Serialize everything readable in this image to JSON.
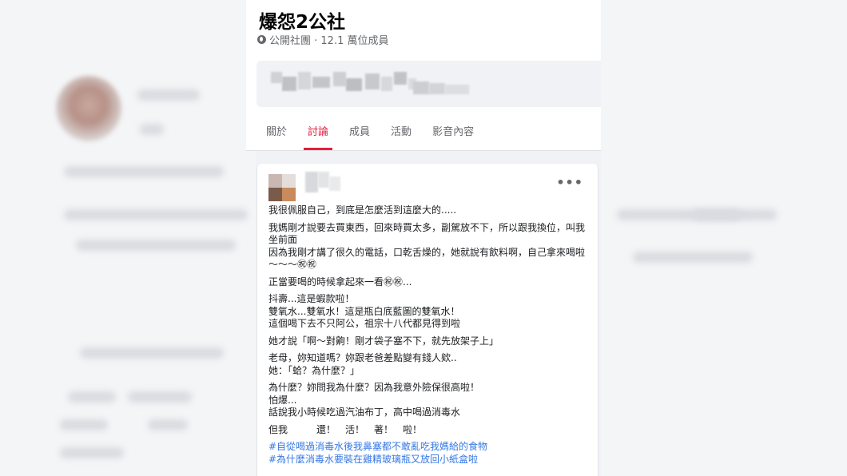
{
  "group": {
    "title": "爆怨2公社",
    "meta": "公開社團 · 12.1 萬位成員"
  },
  "tabs": [
    "關於",
    "討論",
    "成員",
    "活動",
    "影音內容"
  ],
  "active_tab": "討論",
  "post": {
    "more_icon": "•••",
    "paragraphs": [
      "我很佩服自己，到底是怎麼活到這麼大的.....",
      "我媽剛才說要去買東西，回來時買太多，副駕放不下，所以跟我換位，叫我坐前面\n因為我剛才講了很久的電話，口乾舌燥的，她就說有飲料啊，自己拿來喝啦～～～㊗㊗",
      "正當要喝的時候拿起來一看㊗㊗...",
      "抖壽...這是蝦款啦！\n雙氧水...雙氧水！這是瓶白底藍圖的雙氧水！\n這個喝下去不只阿公，祖宗十八代都見得到啦",
      "她才說「啊～對齁！剛才袋子塞不下，就先放架子上」",
      "老母，妳知道嗎？妳跟老爸差點變有錢人欸..\n她：「蛤？為什麼？」",
      "為什麼？妳問我為什麼？因為我意外險保很高啦！\n怕爆...\n話說我小時候吃過汽油布丁，高中喝過消毒水",
      "但我　　　還！　活！　著！　啦！"
    ],
    "hashtags": [
      "#自從喝過消毒水後我鼻塞都不敢亂吃我媽給的食物",
      "#為什麼消毒水要裝在雞精玻璃瓶又放回小紙盒啦"
    ]
  },
  "colors": {
    "accent": "#e41e3f",
    "hashtag": "#3578e5",
    "secondary_text": "#65676b"
  }
}
